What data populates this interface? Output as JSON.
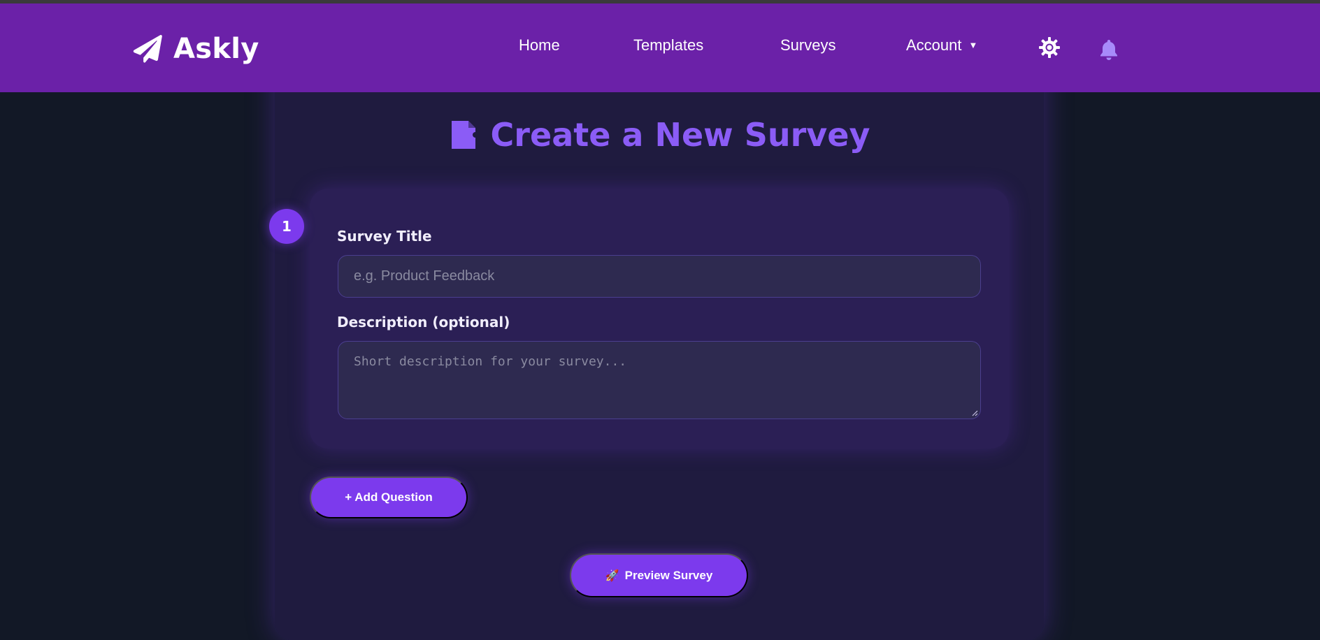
{
  "app": {
    "name": "Askly"
  },
  "nav": {
    "home": "Home",
    "templates": "Templates",
    "surveys": "Surveys",
    "account": "Account",
    "account_caret": "▼"
  },
  "page": {
    "title": "Create a New Survey"
  },
  "form": {
    "step_number": "1",
    "title_label": "Survey Title",
    "title_placeholder": "e.g. Product Feedback",
    "description_label": "Description (optional)",
    "description_placeholder": "Short description for your survey..."
  },
  "buttons": {
    "add_question": "+ Add Question",
    "preview_icon": "🚀",
    "preview": "Preview Survey"
  },
  "icons": {
    "logo": "paper-plane-icon",
    "settings": "gear-icon",
    "notifications": "bell-icon",
    "title_icon": "document-icon"
  },
  "colors": {
    "navbar": "#6b21a8",
    "accent": "#7c3aed",
    "heading": "#8b5cf6",
    "background": "#121826",
    "card": "#1f1b3f",
    "section": "#2b1f55"
  }
}
